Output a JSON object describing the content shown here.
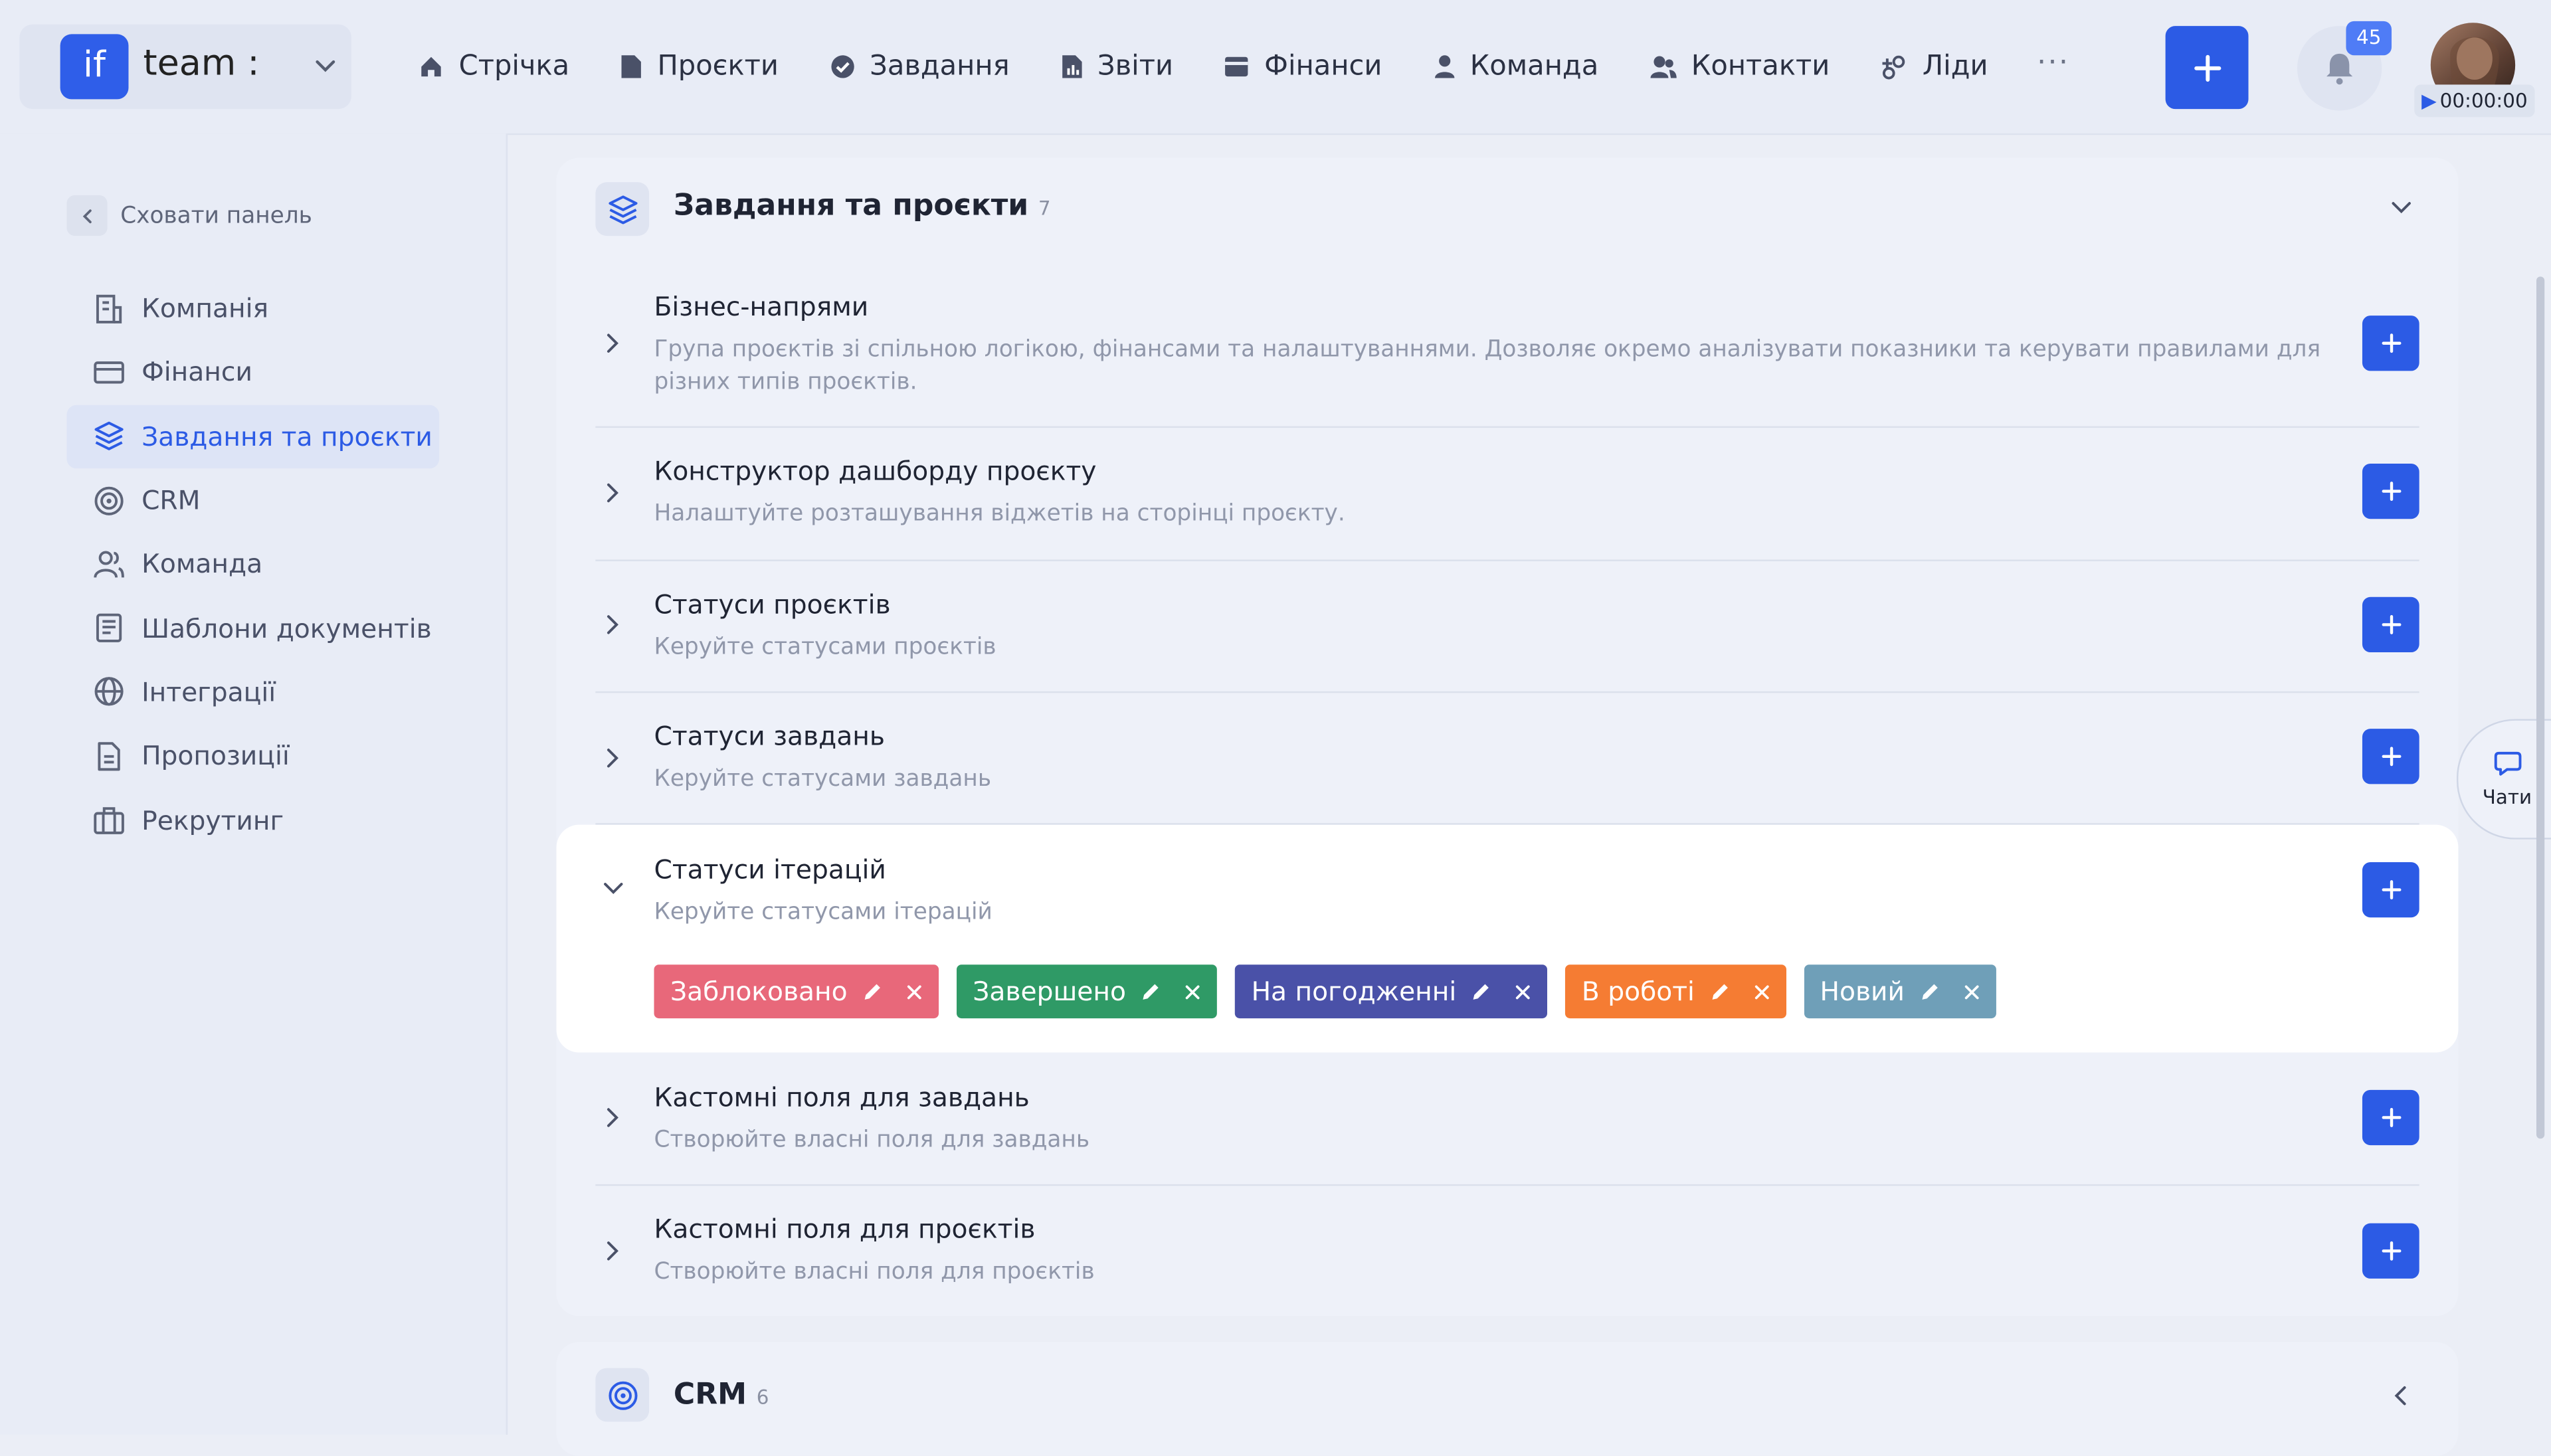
{
  "workspace": {
    "logo": "if",
    "name": "team :",
    "chevron_icon": "chevron-down-icon"
  },
  "nav": [
    {
      "label": "Стрічка",
      "icon": "home-icon"
    },
    {
      "label": "Проєкти",
      "icon": "file-icon"
    },
    {
      "label": "Завдання",
      "icon": "check-circle-icon"
    },
    {
      "label": "Звіти",
      "icon": "report-icon"
    },
    {
      "label": "Фінанси",
      "icon": "wallet-icon"
    },
    {
      "label": "Команда",
      "icon": "user-icon"
    },
    {
      "label": "Контакти",
      "icon": "contacts-icon"
    },
    {
      "label": "Ліди",
      "icon": "leads-icon"
    }
  ],
  "nav_more": "···",
  "notifications": {
    "count": "45",
    "icon": "bell-icon"
  },
  "timer": {
    "value": "00:00:00",
    "icon": "play-icon"
  },
  "sidebar": {
    "hide_label": "Сховати панель",
    "items": [
      {
        "label": "Компанія",
        "icon": "company-icon",
        "active": false
      },
      {
        "label": "Фінанси",
        "icon": "card-icon",
        "active": false
      },
      {
        "label": "Завдання та проєкти",
        "icon": "layers-icon",
        "active": true
      },
      {
        "label": "CRM",
        "icon": "target-icon",
        "active": false
      },
      {
        "label": "Команда",
        "icon": "team-icon",
        "active": false
      },
      {
        "label": "Шаблони документів",
        "icon": "document-icon",
        "active": false
      },
      {
        "label": "Інтеграції",
        "icon": "globe-icon",
        "active": false
      },
      {
        "label": "Пропозиції",
        "icon": "proposal-icon",
        "active": false
      },
      {
        "label": "Рекрутинг",
        "icon": "briefcase-icon",
        "active": false
      }
    ]
  },
  "main": {
    "section_title": "Завдання та проєкти",
    "section_count": "7",
    "rows": [
      {
        "title": "Бізнес-напрями",
        "desc": "Група проєктів зі спільною логікою, фінансами та налаштуваннями. Дозволяє окремо аналізувати показники та керувати правилами для різних типів проєктів."
      },
      {
        "title": "Конструктор дашборду проєкту",
        "desc": "Налаштуйте розташування віджетів на сторінці проєкту."
      },
      {
        "title": "Статуси проєктів",
        "desc": "Керуйте статусами проєктів"
      },
      {
        "title": "Статуси завдань",
        "desc": "Керуйте статусами завдань"
      },
      {
        "title": "Статуси ітерацій",
        "desc": "Керуйте статусами ітерацій"
      },
      {
        "title": "Кастомні поля для завдань",
        "desc": "Створюйте власні поля для завдань"
      },
      {
        "title": "Кастомні поля для проєктів",
        "desc": "Створюйте власні поля для проєктів"
      }
    ],
    "iteration_statuses": [
      {
        "label": "Заблоковано",
        "color": "#e8687a"
      },
      {
        "label": "Завершено",
        "color": "#2f9a66"
      },
      {
        "label": "На погодженні",
        "color": "#4a51a8"
      },
      {
        "label": "В роботі",
        "color": "#f57c33"
      },
      {
        "label": "Новий",
        "color": "#6f9fb8"
      }
    ],
    "next_section_title": "CRM",
    "next_section_count": "6"
  },
  "chat": {
    "label": "Чати",
    "icon": "chat-icon"
  },
  "colors": {
    "accent": "#2c5be5",
    "background": "#ebeef6"
  }
}
